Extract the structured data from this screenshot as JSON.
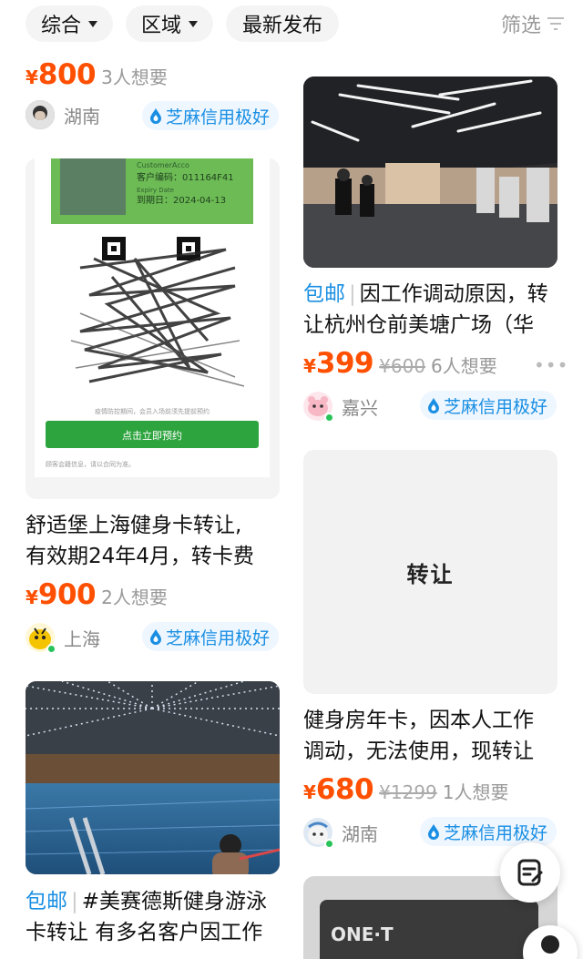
{
  "filters": {
    "sort": "综合",
    "region": "区域",
    "latest": "最新发布",
    "filter": "筛选"
  },
  "badge_text": "芝麻信用极好",
  "colors": {
    "price": "#ff4f00",
    "badge": "#1a8fe3",
    "online": "#28c45a"
  },
  "cards": {
    "c1": {
      "yen": "¥",
      "price": "800",
      "want": "3人想要",
      "city": "湖南",
      "badge": "芝麻信用极好"
    },
    "c2": {
      "title_l1": "舒适堡上海健身卡转让,",
      "title_l2": "有效期24年4月，转卡费",
      "yen": "¥",
      "price": "900",
      "want": "2人想要",
      "city": "上海",
      "badge": "芝麻信用极好",
      "img": {
        "card_top": "CustomerAcco",
        "code_label": "客户编码：011164F41",
        "expiry_en": "Expiry Date",
        "expiry": "到期日：2024-04-13",
        "notice": "疫情防控期间，会员入场前须先提前预约",
        "button": "点击立即预约",
        "footer": "顾客会籍信息，请以合同为准。"
      }
    },
    "c3": {
      "mail": "包邮",
      "hashtag": "#美赛德斯健身游泳",
      "title_l2": "卡转让 有多名客户因工作"
    },
    "c4": {
      "mail": "包邮",
      "title_l1": "因工作调动原因，转",
      "title_l2": "让杭州仓前美塘广场（华",
      "yen": "¥",
      "price": "399",
      "orig": "¥600",
      "want": "6人想要",
      "city": "嘉兴",
      "badge": "芝麻信用极好",
      "more": "•••"
    },
    "c5": {
      "img_text": "转让",
      "title_l1": "健身房年卡，因本人工作",
      "title_l2": "调动，无法使用，现转让",
      "yen": "¥",
      "price": "680",
      "orig": "¥1299",
      "want": "1人想要",
      "city": "湖南",
      "badge": "芝麻信用极好"
    },
    "c6": {
      "img_text": "ONE·T"
    }
  },
  "icons": [
    "chevron-down-icon",
    "filter-icon",
    "sesame-credit-icon",
    "edit-note-icon",
    "chat-icon"
  ]
}
